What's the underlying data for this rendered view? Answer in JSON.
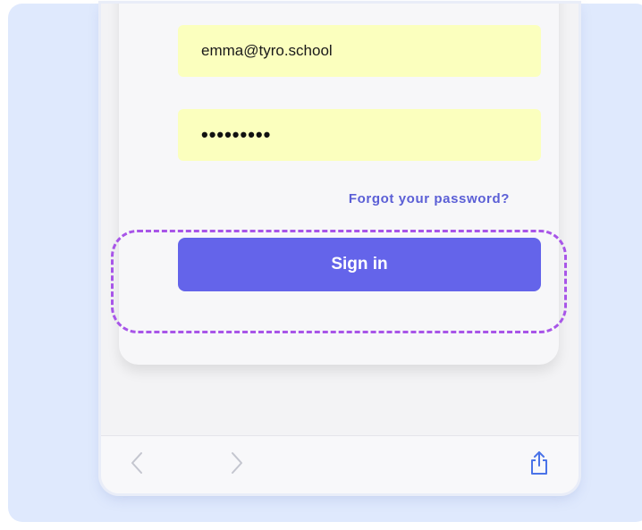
{
  "login_form": {
    "email_value": "emma@tyro.school",
    "password_value": "•••••••••",
    "forgot_link": "Forgot your password?",
    "signin_label": "Sign in"
  },
  "browser_toolbar": {
    "back_icon": "chevron-left-icon",
    "forward_icon": "chevron-right-icon",
    "share_icon": "share-icon"
  },
  "colors": {
    "background": "#dfe9fd",
    "field_fill": "#fbffbe",
    "accent": "#6464ea",
    "highlight": "#a855e8",
    "link": "#5b5fd6"
  }
}
